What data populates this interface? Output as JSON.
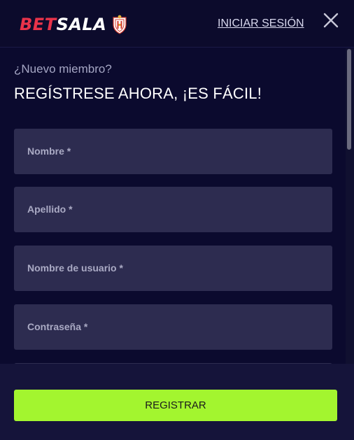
{
  "header": {
    "logo_part1": "BET",
    "logo_part2": "SALA",
    "login_label": "INICIAR SESIÓN"
  },
  "form": {
    "subtitle": "¿Nuevo miembro?",
    "title": "REGÍSTRESE AHORA, ¡ES FÁCIL!",
    "fields": [
      {
        "placeholder": "Nombre *",
        "value": ""
      },
      {
        "placeholder": "Apellido *",
        "value": ""
      },
      {
        "placeholder": "Nombre de usuario *",
        "value": ""
      },
      {
        "placeholder": "Contraseña *",
        "value": ""
      }
    ]
  },
  "footer": {
    "register_label": "REGISTRAR"
  },
  "colors": {
    "background": "#0b0a2e",
    "field_bg": "#2d2c50",
    "brand_red": "#e8334a",
    "accent_green": "#a3f52f"
  },
  "icons": {
    "crest": "club-crest-icon",
    "close": "close-icon"
  }
}
